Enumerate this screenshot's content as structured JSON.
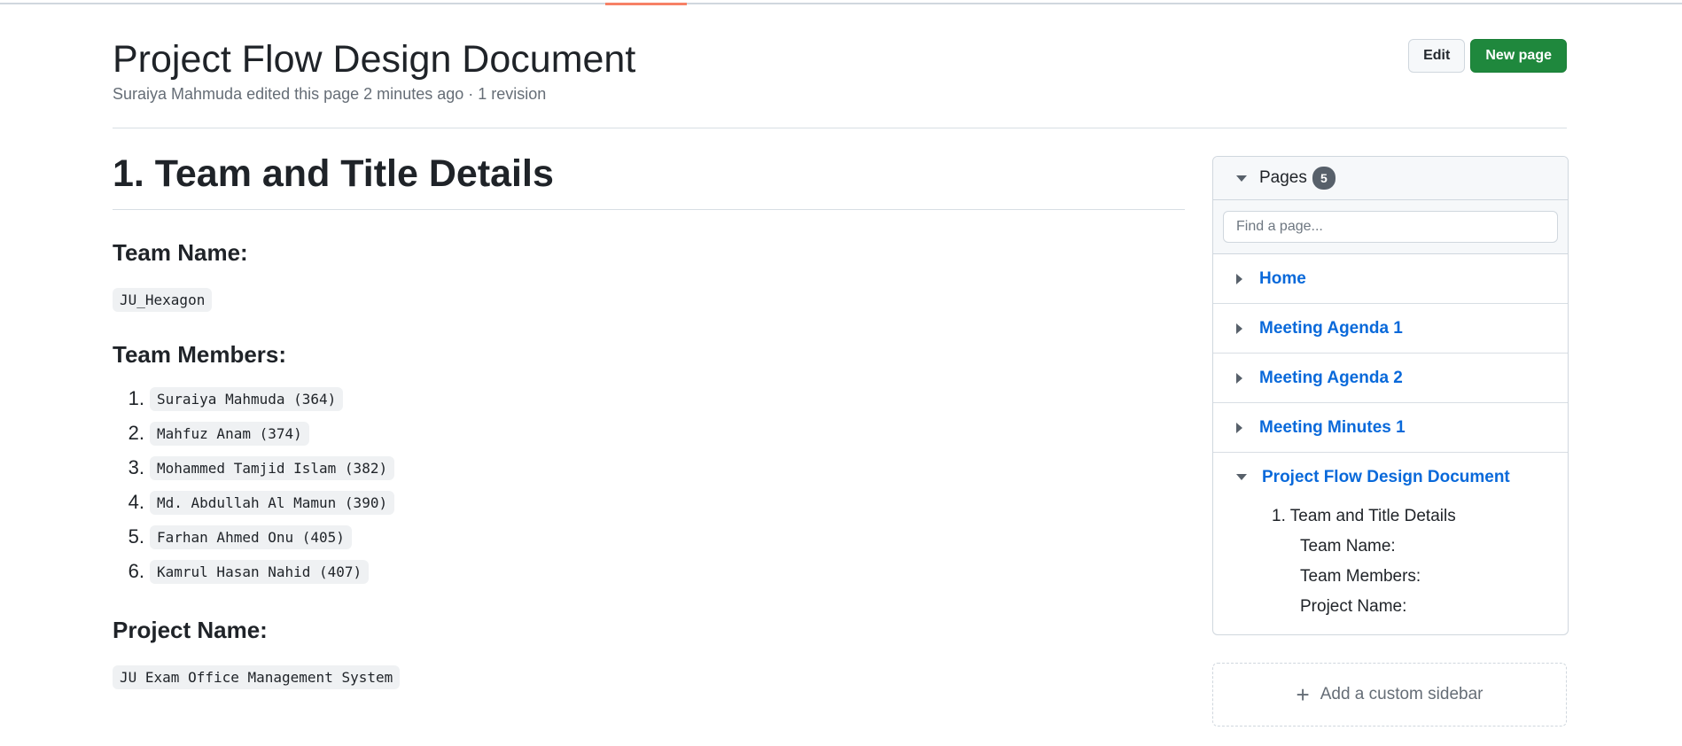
{
  "header": {
    "title": "Project Flow Design Document",
    "meta": "Suraiya Mahmuda edited this page 2 minutes ago · 1 revision",
    "edit_label": "Edit",
    "new_page_label": "New page"
  },
  "content": {
    "section_title": "1. Team and Title Details",
    "team_name_heading": "Team Name:",
    "team_name_value": "JU_Hexagon",
    "team_members_heading": "Team Members:",
    "members": [
      {
        "num": "1.",
        "name": "Suraiya Mahmuda (364)"
      },
      {
        "num": "2.",
        "name": "Mahfuz Anam (374)"
      },
      {
        "num": "3.",
        "name": "Mohammed Tamjid Islam (382)"
      },
      {
        "num": "4.",
        "name": "Md. Abdullah Al Mamun (390)"
      },
      {
        "num": "5.",
        "name": "Farhan Ahmed Onu (405)"
      },
      {
        "num": "6.",
        "name": "Kamrul Hasan Nahid (407)"
      }
    ],
    "project_name_heading": "Project Name:",
    "project_name_value": "JU Exam Office Management System"
  },
  "sidebar": {
    "title": "Pages",
    "count": "5",
    "search_placeholder": "Find a page...",
    "pages": [
      {
        "label": "Home"
      },
      {
        "label": "Meeting Agenda 1"
      },
      {
        "label": "Meeting Agenda 2"
      },
      {
        "label": "Meeting Minutes 1"
      },
      {
        "label": "Project Flow Design Document"
      }
    ],
    "toc": {
      "section": "1. Team and Title Details",
      "items": [
        "Team Name:",
        "Team Members:",
        "Project Name:"
      ]
    },
    "custom_sidebar_label": "Add a custom sidebar"
  }
}
